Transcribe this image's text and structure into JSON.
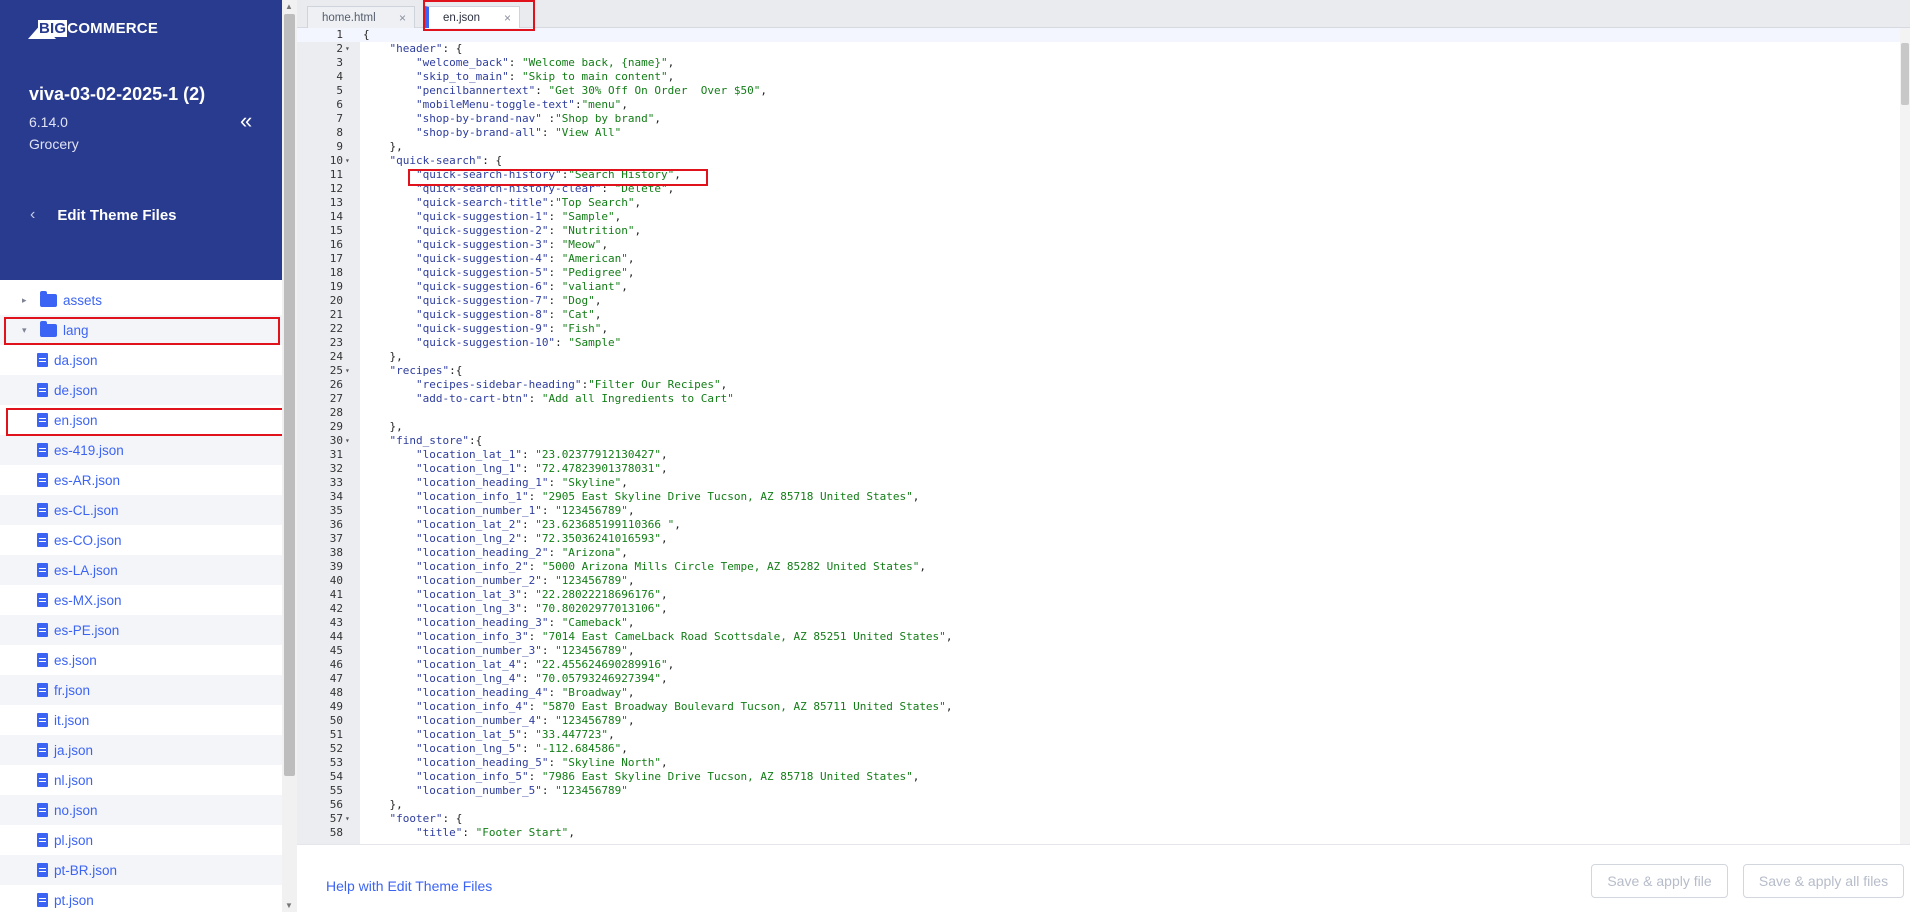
{
  "sidebar": {
    "logo_prefix": "BIG",
    "logo_text": "COMMERCE",
    "store_name": "viva-03-02-2025-1 (2)",
    "version": "6.14.0",
    "category": "Grocery",
    "collapse_icon": "«",
    "back_icon": "‹",
    "edit_label": "Edit Theme Files",
    "tree": [
      {
        "label": "assets",
        "type": "folder",
        "caret": "▸"
      },
      {
        "label": "lang",
        "type": "folder",
        "caret": "▾"
      },
      {
        "label": "da.json",
        "type": "file"
      },
      {
        "label": "de.json",
        "type": "file"
      },
      {
        "label": "en.json",
        "type": "file"
      },
      {
        "label": "es-419.json",
        "type": "file"
      },
      {
        "label": "es-AR.json",
        "type": "file"
      },
      {
        "label": "es-CL.json",
        "type": "file"
      },
      {
        "label": "es-CO.json",
        "type": "file"
      },
      {
        "label": "es-LA.json",
        "type": "file"
      },
      {
        "label": "es-MX.json",
        "type": "file"
      },
      {
        "label": "es-PE.json",
        "type": "file"
      },
      {
        "label": "es.json",
        "type": "file"
      },
      {
        "label": "fr.json",
        "type": "file"
      },
      {
        "label": "it.json",
        "type": "file"
      },
      {
        "label": "ja.json",
        "type": "file"
      },
      {
        "label": "nl.json",
        "type": "file"
      },
      {
        "label": "no.json",
        "type": "file"
      },
      {
        "label": "pl.json",
        "type": "file"
      },
      {
        "label": "pt-BR.json",
        "type": "file"
      },
      {
        "label": "pt.json",
        "type": "file"
      }
    ]
  },
  "tabs": [
    {
      "label": "home.html",
      "close": "×",
      "active": false
    },
    {
      "label": "en.json",
      "close": "×",
      "active": true
    }
  ],
  "editor": {
    "lines": [
      "{",
      "    \"header\": {",
      "        \"welcome_back\": \"Welcome back, {name}\",",
      "        \"skip_to_main\": \"Skip to main content\",",
      "        \"pencilbannertext\": \"Get 30% Off On Order  Over $50\",",
      "        \"mobileMenu-toggle-text\":\"menu\",",
      "        \"shop-by-brand-nav\" :\"Shop by brand\",",
      "        \"shop-by-brand-all\": \"View All\"",
      "    },",
      "    \"quick-search\": {",
      "        \"quick-search-history\":\"Search History\",",
      "        \"quick-search-history-clear\": \"Delete\",",
      "        \"quick-search-title\":\"Top Search\",",
      "        \"quick-suggestion-1\": \"Sample\",",
      "        \"quick-suggestion-2\": \"Nutrition\",",
      "        \"quick-suggestion-3\": \"Meow\",",
      "        \"quick-suggestion-4\": \"American\",",
      "        \"quick-suggestion-5\": \"Pedigree\",",
      "        \"quick-suggestion-6\": \"valiant\",",
      "        \"quick-suggestion-7\": \"Dog\",",
      "        \"quick-suggestion-8\": \"Cat\",",
      "        \"quick-suggestion-9\": \"Fish\",",
      "        \"quick-suggestion-10\": \"Sample\"",
      "    },",
      "    \"recipes\":{",
      "        \"recipes-sidebar-heading\":\"Filter Our Recipes\",",
      "        \"add-to-cart-btn\": \"Add all Ingredients to Cart\"",
      "",
      "    },",
      "    \"find_store\":{",
      "        \"location_lat_1\": \"23.02377912130427\",",
      "        \"location_lng_1\": \"72.47823901378031\",",
      "        \"location_heading_1\": \"Skyline\",",
      "        \"location_info_1\": \"2905 East Skyline Drive Tucson, AZ 85718 United States\",",
      "        \"location_number_1\": \"123456789\",",
      "        \"location_lat_2\": \"23.623685199110366 \",",
      "        \"location_lng_2\": \"72.35036241016593\",",
      "        \"location_heading_2\": \"Arizona\",",
      "        \"location_info_2\": \"5000 Arizona Mills Circle Tempe, AZ 85282 United States\",",
      "        \"location_number_2\": \"123456789\",",
      "        \"location_lat_3\": \"22.28022218696176\",",
      "        \"location_lng_3\": \"70.80202977013106\",",
      "        \"location_heading_3\": \"Cameback\",",
      "        \"location_info_3\": \"7014 East CameLback Road Scottsdale, AZ 85251 United States\",",
      "        \"location_number_3\": \"123456789\",",
      "        \"location_lat_4\": \"22.455624690289916\",",
      "        \"location_lng_4\": \"70.05793246927394\",",
      "        \"location_heading_4\": \"Broadway\",",
      "        \"location_info_4\": \"5870 East Broadway Boulevard Tucson, AZ 85711 United States\",",
      "        \"location_number_4\": \"123456789\",",
      "        \"location_lat_5\": \"33.447723\",",
      "        \"location_lng_5\": \"-112.684586\",",
      "        \"location_heading_5\": \"Skyline North\",",
      "        \"location_info_5\": \"7986 East Skyline Drive Tucson, AZ 85718 United States\",",
      "        \"location_number_5\": \"123456789\"",
      "    },",
      "    \"footer\": {",
      "        \"title\": \"Footer Start\","
    ],
    "fold_lines": [
      2,
      10,
      25,
      30,
      57
    ],
    "fold_icon": "▾"
  },
  "footer": {
    "help_link": "Help with Edit Theme Files",
    "apply_button": "Save & apply file",
    "apply_all_button": "Save & apply all files"
  },
  "colors": {
    "sidebar_header": "#293b8f",
    "accent": "#3c64f4",
    "highlight": "#e0121c",
    "json_key": "#2e3d9e",
    "json_string": "#127d16"
  }
}
